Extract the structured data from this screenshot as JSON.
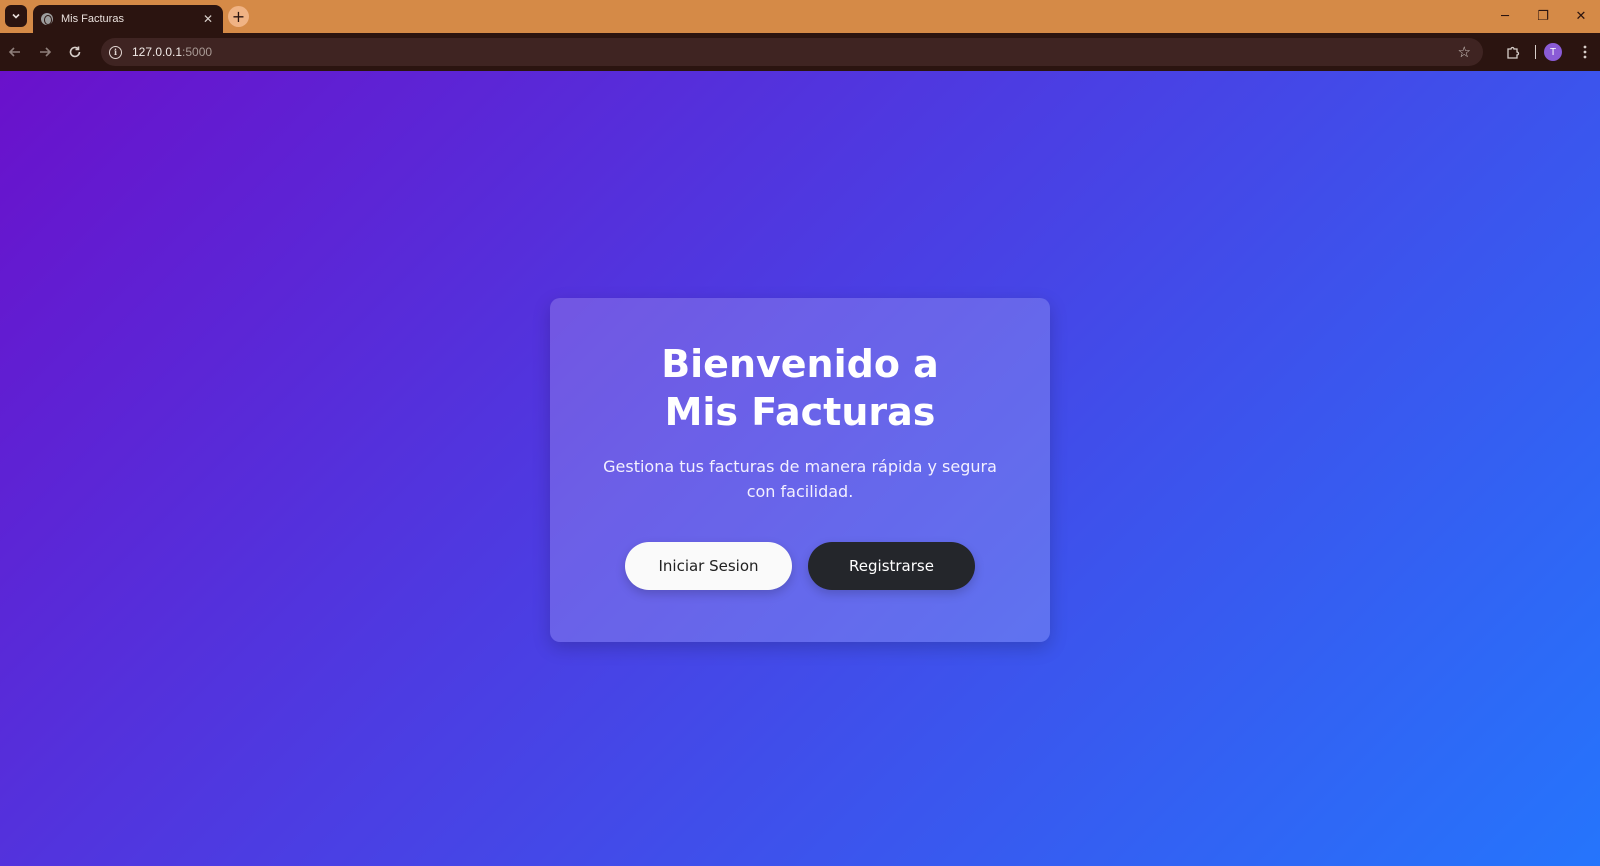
{
  "browser": {
    "tab": {
      "title": "Mis Facturas",
      "close_glyph": "✕"
    },
    "new_tab_glyph": "+",
    "url": {
      "host": "127.0.0.1",
      "port": ":5000"
    },
    "profile_initial": "T",
    "window_controls": {
      "minimize": "─",
      "restore": "❐",
      "close": "✕"
    },
    "icons": {
      "tab_search": "chevron-down-icon",
      "back": "back-arrow-icon",
      "forward": "forward-arrow-icon",
      "reload": "reload-icon",
      "site_info": "info-icon",
      "bookmark": "star-icon",
      "extensions": "puzzle-icon",
      "menu": "kebab-menu-icon"
    }
  },
  "page": {
    "title": "Bienvenido a Mis Facturas",
    "subtitle": "Gestiona tus facturas de manera rápida y segura con facilidad.",
    "buttons": {
      "login": "Iniciar Sesion",
      "register": "Registrarse"
    },
    "colors": {
      "gradient_start": "#6a11cb",
      "gradient_end": "#2575fc",
      "login_button_bg": "#fafafa",
      "register_button_bg": "#24262b",
      "browser_frame": "#d58a47",
      "browser_toolbar": "#2b1410"
    }
  }
}
